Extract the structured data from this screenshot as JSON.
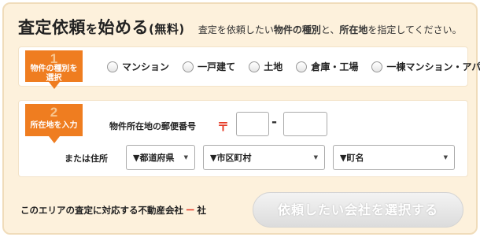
{
  "header": {
    "title_main": "査定依頼",
    "title_particle": "を",
    "title_rest": "始める",
    "title_paren": "(無料)",
    "desc_pre": "査定を依頼したい",
    "desc_bold1": "物件の種別",
    "desc_mid": "と、",
    "desc_bold2": "所在地",
    "desc_post": "を指定してください。"
  },
  "step1": {
    "number": "1",
    "label": "物件の種別を選択",
    "options": [
      "マンション",
      "一戸建て",
      "土地",
      "倉庫・工場",
      "一棟マンション・アパート"
    ]
  },
  "step2": {
    "number": "2",
    "label": "所在地を入力",
    "postal_label": "物件所在地の郵便番号",
    "postal_icon": "〒",
    "dash": "-",
    "zip1_value": "",
    "zip2_value": "",
    "address_label": "または住所",
    "prefecture": "▼都道府県",
    "city": "▼市区町村",
    "town": "▼町名"
  },
  "footer": {
    "text_pre": "このエリアの査定に対応する不動産会社",
    "count": "ー",
    "text_post": "社",
    "submit_label": "依頼したい会社を選択する"
  },
  "colors": {
    "accent": "#ef7d20",
    "background": "#fdf1dc",
    "postal_red": "#e53a26"
  }
}
